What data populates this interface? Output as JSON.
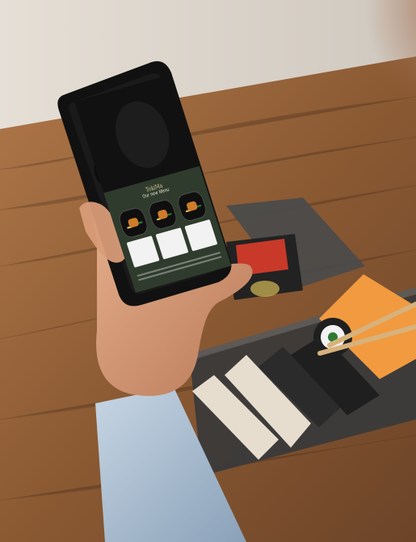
{
  "phone_screen": {
    "title": "TokiMa",
    "subtitle": "Our new Menu"
  },
  "colors": {
    "table_wood": "#8a5a33",
    "phone_panel_green": "#2f3b2c",
    "salmon_roll_orange": "#f29a3f"
  }
}
